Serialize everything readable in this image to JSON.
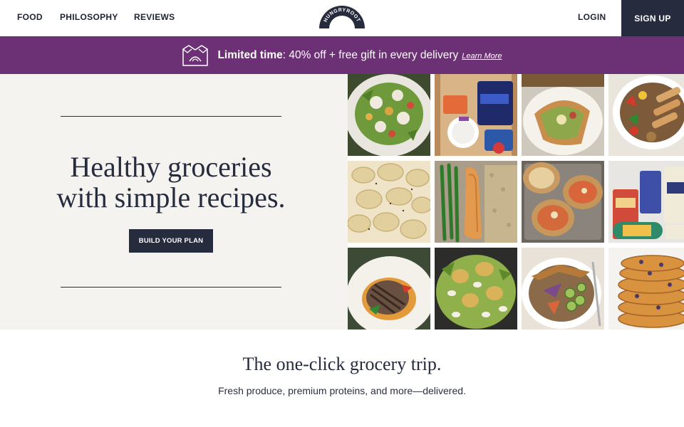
{
  "nav": {
    "links": [
      "FOOD",
      "PHILOSOPHY",
      "REVIEWS"
    ],
    "brand": "HUNGRYROOT",
    "login": "LOGIN",
    "signup": "SIGN UP"
  },
  "promo": {
    "bold": "Limited time",
    "text": ": 40% off + free gift in every delivery",
    "link": "Learn More"
  },
  "hero": {
    "title_line1": "Healthy groceries",
    "title_line2": "with simple recipes.",
    "cta": "BUILD YOUR PLAN"
  },
  "grid": {
    "tiles": [
      "salad-plate-photo",
      "grocery-box-photo",
      "flatbread-photo",
      "chicken-bowl-photo",
      "pasta-photo",
      "salmon-greenbeans-photo",
      "stuffed-bread-photo",
      "grocery-products-photo",
      "grilled-patty-photo",
      "potato-greens-photo",
      "grain-bowl-photo",
      "pancakes-photo"
    ]
  },
  "section": {
    "title": "The one-click grocery trip.",
    "subtitle": "Fresh produce, premium proteins, and more—delivered."
  },
  "colors": {
    "navy": "#262b3e",
    "promo_purple": "#6c3174",
    "hero_bg": "#f4f3ef"
  }
}
